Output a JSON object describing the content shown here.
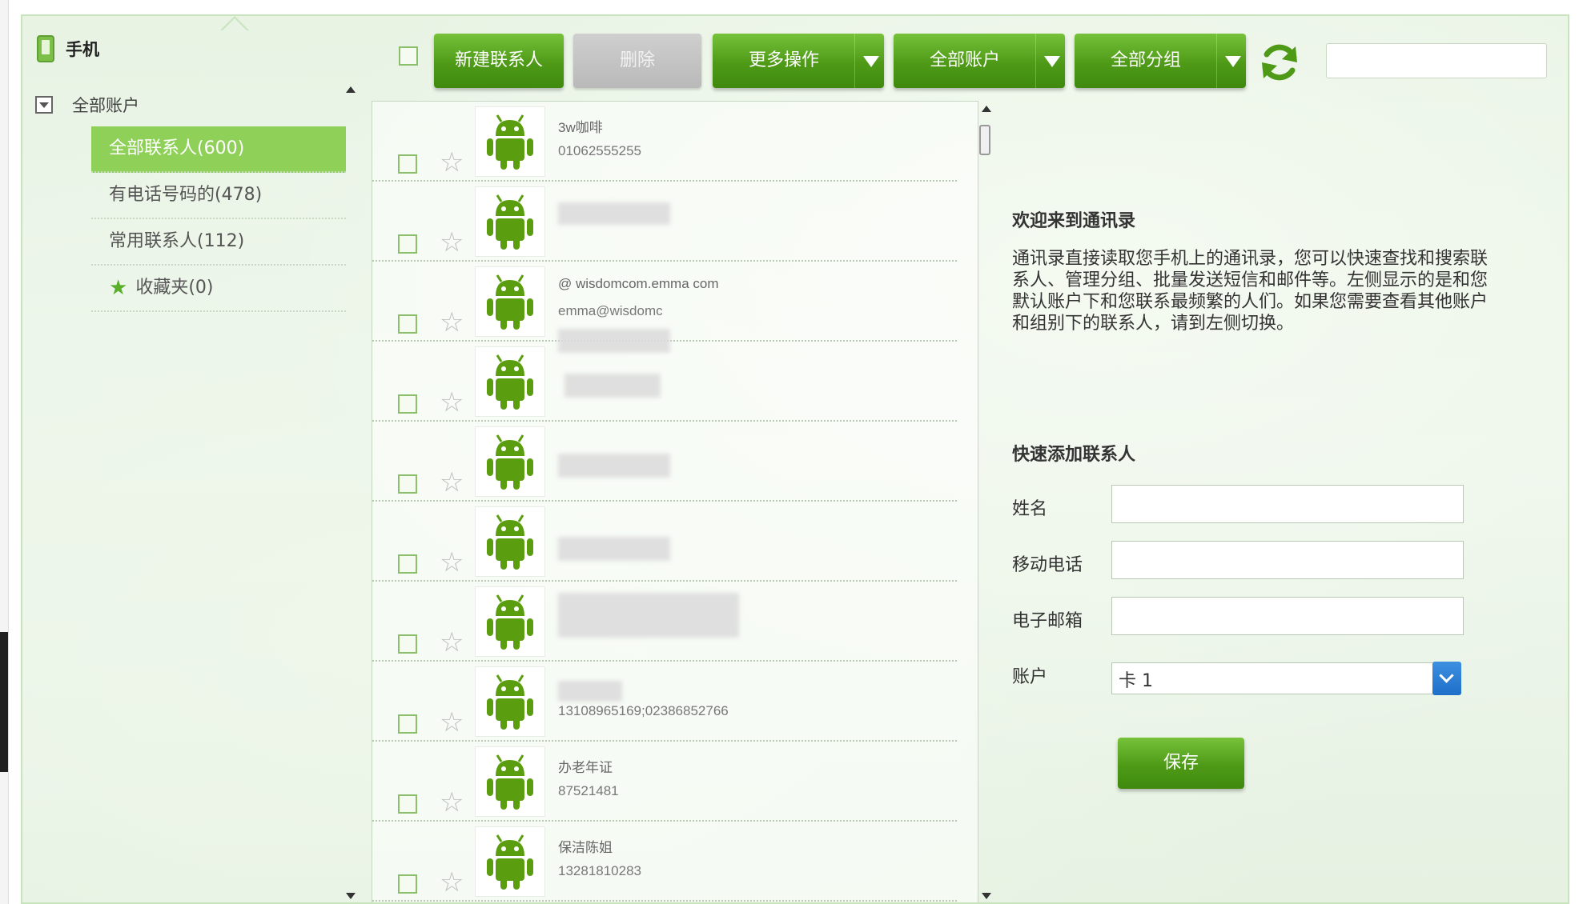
{
  "sidebar": {
    "phone_title": "手机",
    "account_label": "全部账户",
    "groups": [
      {
        "label": "全部联系人(600)"
      },
      {
        "label": "有电话号码的(478)"
      },
      {
        "label": "常用联系人(112)"
      },
      {
        "label": "收藏夹(0)"
      }
    ]
  },
  "toolbar": {
    "new_contact": "新建联系人",
    "delete": "删除",
    "more_actions": "更多操作",
    "all_accounts": "全部账户",
    "all_groups": "全部分组",
    "search_value": ""
  },
  "contacts": [
    {
      "name": "3w咖啡",
      "phone": "01062555255"
    },
    {
      "name": "",
      "phone": ""
    },
    {
      "name": "@ wisdomcom.emma com",
      "phone": "emma@wisdomc"
    },
    {
      "name": "",
      "phone": ""
    },
    {
      "name": "",
      "phone": ""
    },
    {
      "name": "",
      "phone": ""
    },
    {
      "name": "",
      "phone": ""
    },
    {
      "name": "",
      "phone": "13108965169;02386852766"
    },
    {
      "name": "办老年证",
      "phone": "87521481"
    },
    {
      "name": "保洁陈姐",
      "phone": "13281810283"
    }
  ],
  "welcome": {
    "title": "欢迎来到通讯录",
    "text": "通讯录直接读取您手机上的通讯录，您可以快速查找和搜索联系人、管理分组、批量发送短信和邮件等。左侧显示的是和您默认账户下和您联系最频繁的人们。如果您需要查看其他账户和组别下的联系人，请到左侧切换。"
  },
  "quick_add": {
    "title": "快速添加联系人",
    "name_label": "姓名",
    "mobile_label": "移动电话",
    "email_label": "电子邮箱",
    "account_label": "账户",
    "account_value": "卡 1",
    "save_label": "保存"
  },
  "colors": {
    "accent": "#4e9a17",
    "active_group": "#8fd158"
  }
}
